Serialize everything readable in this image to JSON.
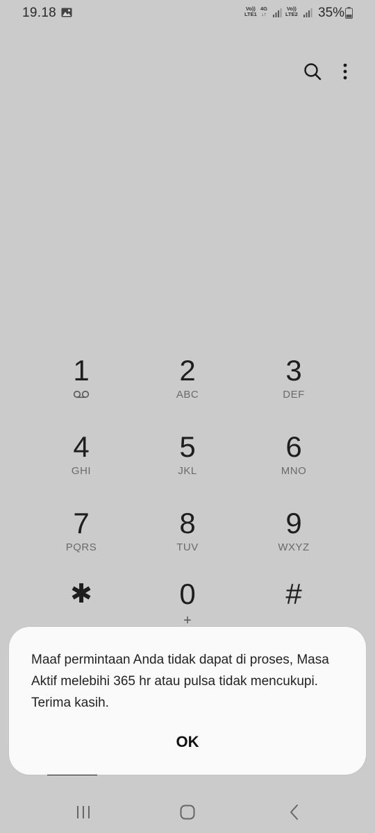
{
  "status_bar": {
    "time": "19.18",
    "sim1": {
      "top": "Vo))",
      "bottom": "LTE1"
    },
    "net": {
      "top": "4G",
      "bottom": "↓↑"
    },
    "sim2": {
      "top": "Vo))",
      "bottom": "LTE2"
    },
    "battery": "35%"
  },
  "toolbar": {
    "search_icon": "search-icon",
    "more_icon": "more-vert-icon"
  },
  "dialpad": {
    "keys": [
      {
        "digit": "1",
        "letters": ""
      },
      {
        "digit": "2",
        "letters": "ABC"
      },
      {
        "digit": "3",
        "letters": "DEF"
      },
      {
        "digit": "4",
        "letters": "GHI"
      },
      {
        "digit": "5",
        "letters": "JKL"
      },
      {
        "digit": "6",
        "letters": "MNO"
      },
      {
        "digit": "7",
        "letters": "PQRS"
      },
      {
        "digit": "8",
        "letters": "TUV"
      },
      {
        "digit": "9",
        "letters": "WXYZ"
      },
      {
        "digit": "✱",
        "letters": ""
      },
      {
        "digit": "0",
        "letters": "+"
      },
      {
        "digit": "#",
        "letters": ""
      }
    ]
  },
  "dialog": {
    "message": "Maaf permintaan Anda tidak dapat di proses, Masa Aktif melebihi 365 hr atau pulsa tidak mencukupi. Terima kasih.",
    "ok_label": "OK"
  },
  "colors": {
    "background": "#cbcbcb",
    "dialog_bg": "#fafafa",
    "text": "#1e1e1e",
    "secondary_text": "#6a6a6a"
  }
}
